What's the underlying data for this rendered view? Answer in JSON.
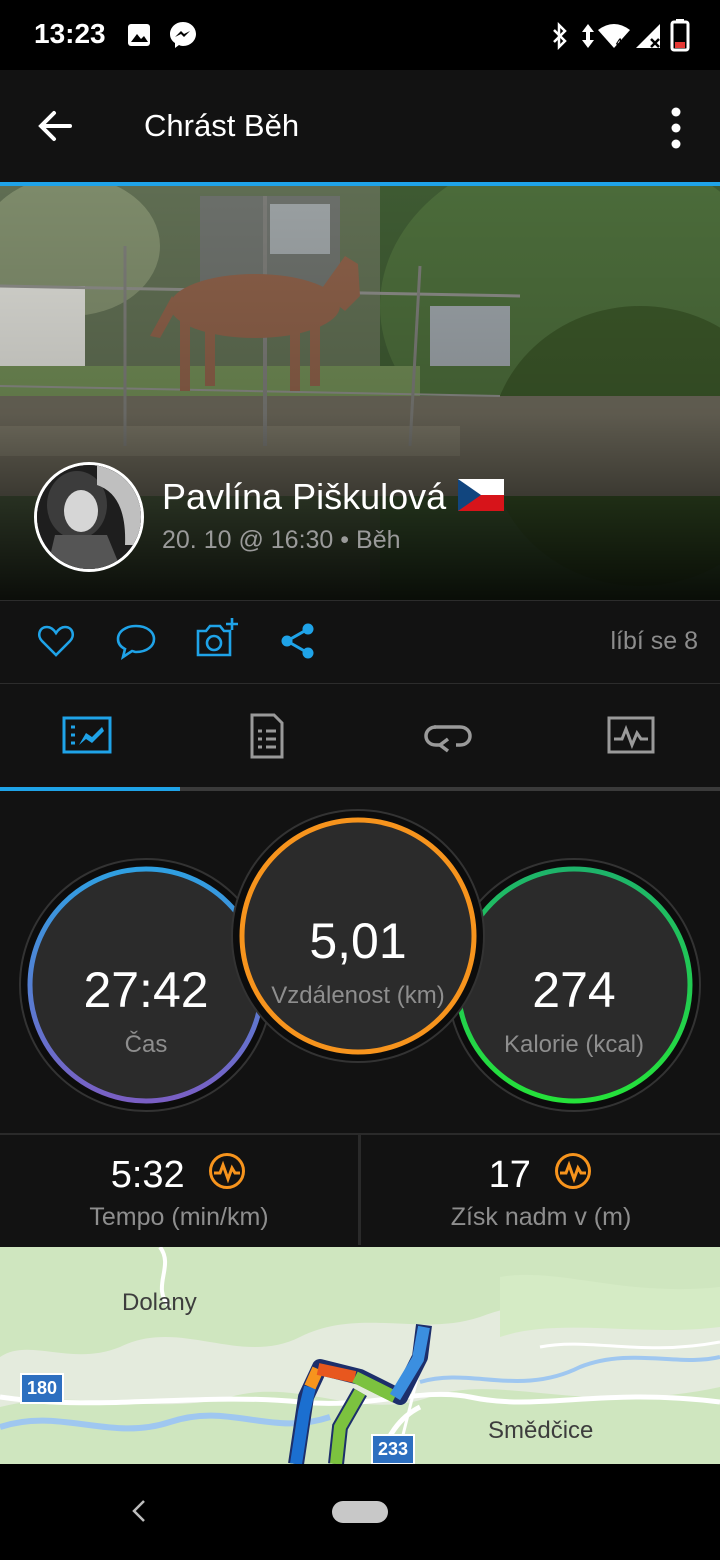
{
  "status_bar": {
    "time": "13:23",
    "icons": [
      "image-icon",
      "messenger-icon",
      "bluetooth-icon",
      "data-arrows-icon",
      "wifi-icon",
      "signal-icon",
      "battery-icon"
    ],
    "network_badge": "4"
  },
  "app_bar": {
    "title": "Chrást Běh",
    "back_icon": "arrow-left-icon",
    "more_icon": "more-vertical-icon"
  },
  "hero": {
    "user_name": "Pavlína Piškulová",
    "flag": "czech-flag",
    "date": "20. 10 @ 16:30",
    "separator": "•",
    "activity_type": "Běh"
  },
  "actions": {
    "icons": [
      "heart-icon",
      "comment-icon",
      "add-photo-icon",
      "share-icon"
    ],
    "likes_text": "líbí se 8"
  },
  "tabs": [
    {
      "name": "overview",
      "icon": "chart-card-icon",
      "active": true
    },
    {
      "name": "details",
      "icon": "document-list-icon",
      "active": false
    },
    {
      "name": "laps",
      "icon": "loop-icon",
      "active": false
    },
    {
      "name": "charts",
      "icon": "activity-graph-icon",
      "active": false
    }
  ],
  "stats": {
    "time": {
      "value": "27:42",
      "label": "Čas"
    },
    "distance": {
      "value": "5,01",
      "label": "Vzdálenost (km)"
    },
    "calories": {
      "value": "274",
      "label": "Kalorie (kcal)"
    }
  },
  "metrics": [
    {
      "value": "5:32",
      "label": "Tempo (min/km)",
      "icon": "pulse-badge-icon"
    },
    {
      "value": "17",
      "label": "Získ nadm v (m)",
      "icon": "pulse-badge-icon"
    }
  ],
  "map": {
    "places": [
      "Dolany",
      "Smědčice"
    ],
    "road_shields": [
      "180",
      "233"
    ]
  },
  "colors": {
    "accent": "#1fa3e8",
    "orange": "#f7941d",
    "green": "#1ed35a",
    "purple": "#7b68c8"
  }
}
